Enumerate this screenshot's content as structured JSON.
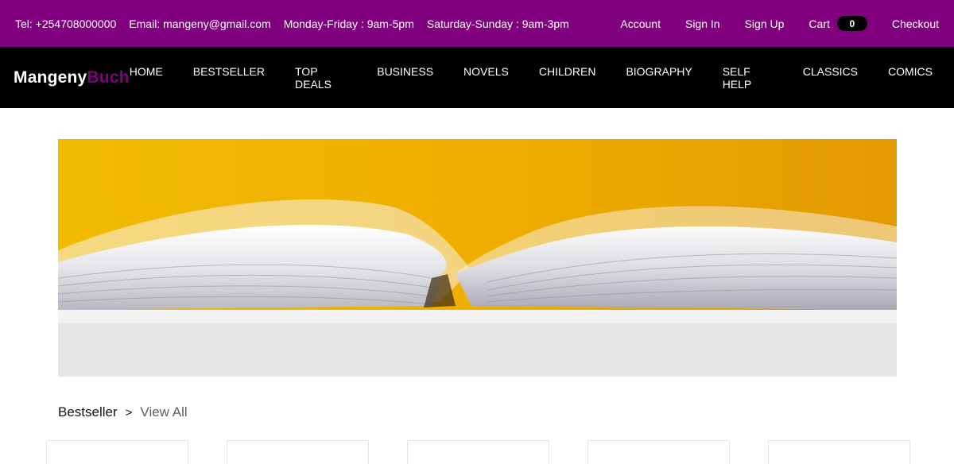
{
  "topbar": {
    "phone": "Tel: +254708000000",
    "email": "Email: mangeny@gmail.com",
    "weekday_hours": "Monday-Friday : 9am-5pm",
    "weekend_hours": "Saturday-Sunday : 9am-3pm",
    "account": "Account",
    "signin": "Sign In",
    "signup": "Sign Up",
    "cart": "Cart",
    "cart_count": "0",
    "checkout": "Checkout"
  },
  "brand": {
    "main": "Mangeny",
    "accent": "Buch",
    "accent_color": "#800080"
  },
  "nav": [
    "HOME",
    "BESTSELLER",
    "TOP DEALS",
    "BUSINESS",
    "NOVELS",
    "CHILDREN",
    "BIOGRAPHY",
    "SELF HELP",
    "CLASSICS",
    "COMICS"
  ],
  "section": {
    "title": "Bestseller",
    "separator": ">",
    "view_all": "View All"
  },
  "colors": {
    "topbar": "#800080",
    "navbar": "#000000"
  }
}
